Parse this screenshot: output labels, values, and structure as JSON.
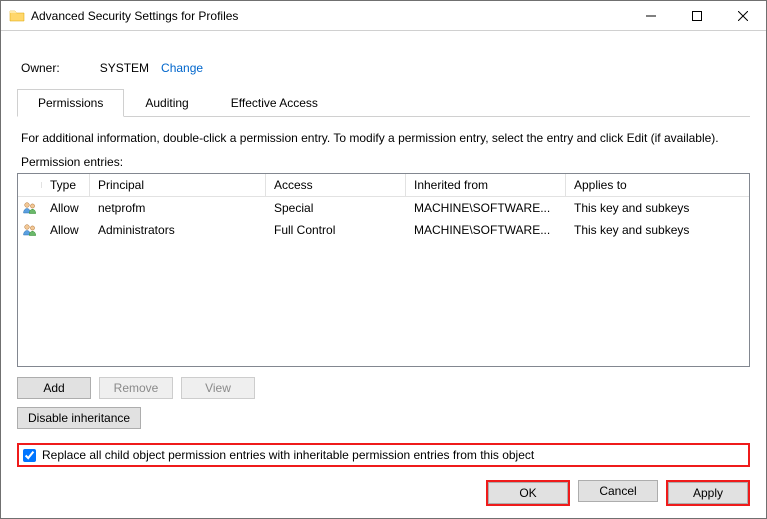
{
  "window": {
    "title": "Advanced Security Settings for Profiles"
  },
  "owner": {
    "label": "Owner:",
    "value": "SYSTEM",
    "change": "Change"
  },
  "tabs": {
    "permissions": "Permissions",
    "auditing": "Auditing",
    "effective": "Effective Access"
  },
  "info": "For additional information, double-click a permission entry. To modify a permission entry, select the entry and click Edit (if available).",
  "entriesLabel": "Permission entries:",
  "columns": {
    "type": "Type",
    "principal": "Principal",
    "access": "Access",
    "inherited": "Inherited from",
    "applies": "Applies to"
  },
  "rows": [
    {
      "type": "Allow",
      "principal": "netprofm",
      "access": "Special",
      "inherited": "MACHINE\\SOFTWARE...",
      "applies": "This key and subkeys"
    },
    {
      "type": "Allow",
      "principal": "Administrators",
      "access": "Full Control",
      "inherited": "MACHINE\\SOFTWARE...",
      "applies": "This key and subkeys"
    }
  ],
  "buttons": {
    "add": "Add",
    "remove": "Remove",
    "view": "View",
    "disableInherit": "Disable inheritance",
    "ok": "OK",
    "cancel": "Cancel",
    "apply": "Apply"
  },
  "checkbox": {
    "label": "Replace all child object permission entries with inheritable permission entries from this object"
  }
}
